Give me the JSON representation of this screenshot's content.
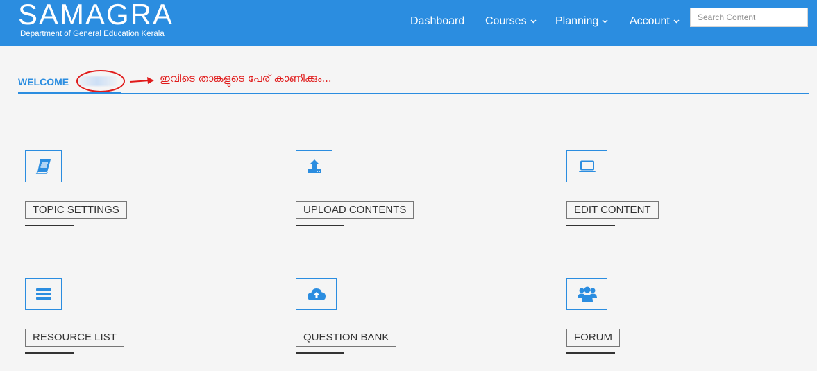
{
  "brand": {
    "title": "SAMAGRA",
    "subtitle": "Department of General Education Kerala"
  },
  "nav": {
    "dashboard": "Dashboard",
    "courses": "Courses",
    "planning": "Planning",
    "account": "Account"
  },
  "search": {
    "placeholder": "Search Content",
    "value": ""
  },
  "welcome": {
    "label": "WELCOME",
    "annotation": "ഇവിടെ താങ്കളുടെ പേര് കാണിക്കും..."
  },
  "cards": [
    {
      "label": "TOPIC SETTINGS",
      "icon": "book-icon"
    },
    {
      "label": "UPLOAD CONTENTS",
      "icon": "upload-icon"
    },
    {
      "label": "EDIT CONTENT",
      "icon": "laptop-icon"
    },
    {
      "label": "RESOURCE LIST",
      "icon": "list-icon"
    },
    {
      "label": "QUESTION BANK",
      "icon": "cloud-upload-icon"
    },
    {
      "label": "FORUM",
      "icon": "users-icon"
    }
  ],
  "colors": {
    "primary": "#2b8de0",
    "annotation": "#e01b1b",
    "background": "#f5f5f5"
  }
}
